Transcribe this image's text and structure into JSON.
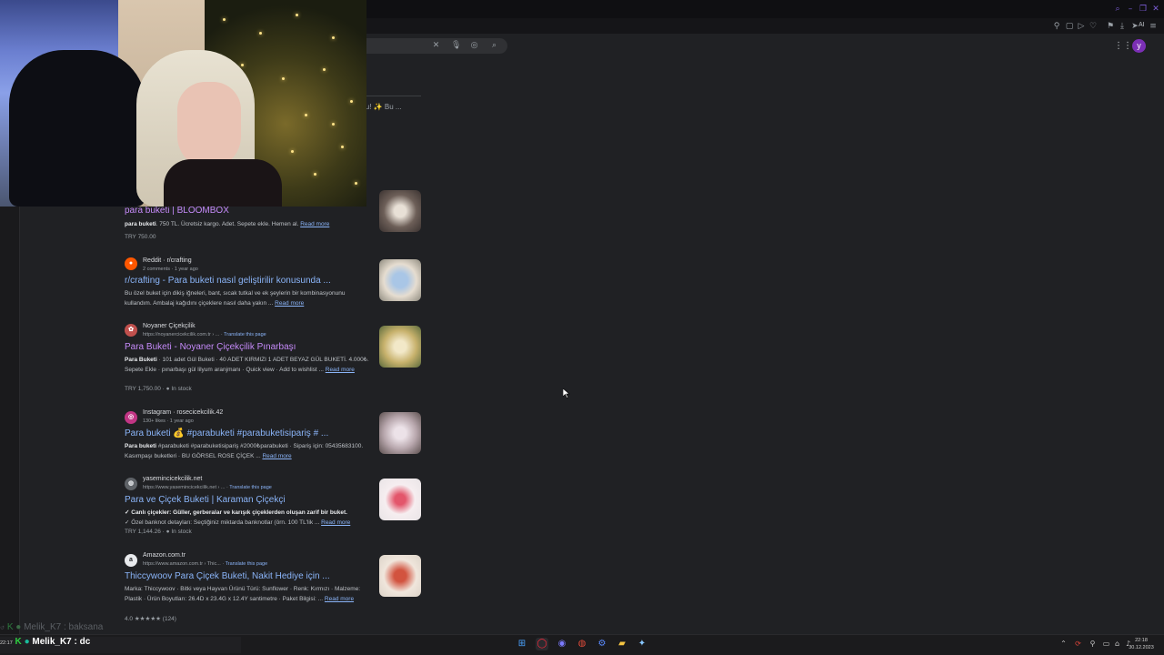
{
  "browser": {
    "toolbar_icons": [
      "pin-icon",
      "tab-icon",
      "play-icon",
      "heart-icon",
      "download-icon",
      "send-icon"
    ],
    "ai_label": "AI",
    "search_icons": [
      "clear-icon",
      "mic-icon",
      "lens-icon",
      "search-icon"
    ],
    "avatar_letter": "y"
  },
  "page": {
    "ai_snippet": "lu! ✨ Bu ..."
  },
  "results": [
    {
      "title": "para buketi | BLOOMBOX",
      "snippet_bold": "para buketi",
      "snippet": ". 750 TL. Ücretsiz kargo. Adet. Sepete ekle. Hemen al.",
      "read_more": "Read more",
      "meta": "TRY 750.00"
    },
    {
      "site": "Reddit · r/crafting",
      "url": "2 comments · 1 year ago",
      "title": "r/crafting - Para buketi nasıl geliştirilir konusunda ...",
      "snippet": "Bu özel buket için dikiş iğneleri, bant, sıcak tutkal ve ek şeylerin bir kombinasyonunu kullandım. Ambalaj kağıdını çiçeklere nasıl daha yakın ...",
      "read_more": "Read more"
    },
    {
      "site": "Noyaner Çiçekçilik",
      "url": "https://noyanercicekcilik.com.tr › ...",
      "translate": "Translate this page",
      "title": "Para Buketi - Noyaner Çiçekçilik Pınarbaşı",
      "snippet_bold": "Para Buketi",
      "snippet": " · 101 adet Gül Buketi · 40 ADET KIRMIZI 1 ADET BEYAZ GÜL BUKETİ. 4.000₺. Sepete Ekle · pınarbaşı gül lilyum aranjmanı · Quick view · Add to wishlist ...",
      "read_more": "Read more",
      "meta": "TRY 1,750.00 · ● In stock"
    },
    {
      "site": "Instagram · rosecicekcilik.42",
      "url": "130+ likes · 1 year ago",
      "title": "Para buketi 💰 #parabuketi #parabuketisipariş # ...",
      "snippet_bold": "Para buketi",
      "snippet": " #parabuketi #parabuketisipariş #2000₺parabuketi · Sipariş için: 05435683100. Kasımpaşı buketleri · BU GÖRSEL ROSE ÇİÇEK ...",
      "read_more": "Read more"
    },
    {
      "site": "yasemincicekcilik.net",
      "url": "https://www.yasemincicekcilik.net › ...",
      "translate": "Translate this page",
      "title": "Para ve Çiçek Buketi | Karaman Çiçekçi",
      "snippet_bold": "✓ Canlı çiçekler: Güller, gerberalar ve karışık çiçeklerden oluşan zarif bir buket.",
      "snippet": "✓ Özel banknot detayları: Seçtiğiniz miktarda banknotlar (örn. 100 TL'lik ...",
      "read_more": "Read more",
      "meta": "TRY 1,144.26 · ● In stock"
    },
    {
      "site": "Amazon.com.tr",
      "url": "https://www.amazon.com.tr › Thic...",
      "translate": "Translate this page",
      "title": "Thiccywoov Para Çiçek Buketi, Nakit Hediye için ...",
      "snippet": "Marka: Thiccywoov · Bitki veya Hayvan Ürünü Türü: Sunflower · Renk: Kırmızı · Malzeme: Plastik · Ürün Boyutları: 26.4D x 23.4G x 12.4Y santimetre · Paket Bilgisi: ...",
      "read_more": "Read more",
      "meta": "4.0 ★★★★★ (124)"
    }
  ],
  "chat": {
    "line1": "Melik_K7 : baksana",
    "line2_user": "Melik_K7",
    "line2_text": ": dc",
    "time1": "22:17"
  },
  "taskbar": {
    "icons": [
      "windows-icon",
      "opera-icon",
      "discord-icon",
      "chrome-icon",
      "settings-icon",
      "file-explorer-icon",
      "app-icon"
    ],
    "clock_time": "22:18",
    "clock_date": "30.12.2023"
  }
}
